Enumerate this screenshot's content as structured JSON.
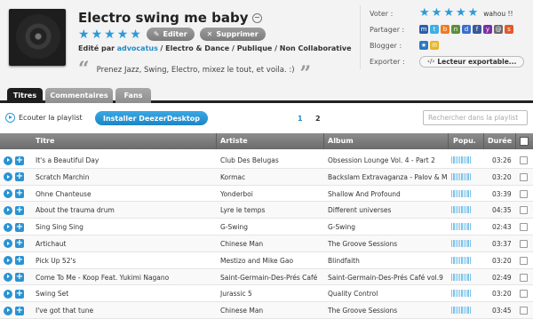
{
  "header": {
    "title": "Electro swing me baby",
    "rating_stars": 5,
    "edit_label": "Editer",
    "delete_label": "Supprimer",
    "edited_by_prefix": "Edité par",
    "author": "advocatus",
    "meta": "/ Electro & Dance / Publique / Non Collaborative",
    "description": "Prenez Jazz, Swing, Electro, mixez le tout, et voila. :)",
    "quote_open": "“",
    "quote_close": "”"
  },
  "side": {
    "vote_label": "Voter :",
    "vote_stars": 5,
    "vote_comment": "wahou !!",
    "share_label": "Partager :",
    "share_icons": [
      "myspace-icon",
      "twitter-icon",
      "blog-icon",
      "netvibes-icon",
      "delicious-icon",
      "facebook-icon",
      "yahoo-icon",
      "email-icon",
      "stumble-icon"
    ],
    "blogger_label": "Blogger :",
    "export_label": "Exporter :",
    "export_button": "Lecteur exportable..."
  },
  "tabs": [
    {
      "label": "Titres",
      "active": true
    },
    {
      "label": "Commentaires",
      "active": false
    },
    {
      "label": "Fans",
      "active": false
    }
  ],
  "toolbar": {
    "listen_label": "Ecouter la playlist",
    "install_label": "Installer DeezerDesktop",
    "pages": [
      "1",
      "2"
    ],
    "search_placeholder": "Rechercher dans la playlist"
  },
  "table": {
    "columns": [
      "Titre",
      "Artiste",
      "Album",
      "Popu.",
      "Durée"
    ],
    "rows": [
      {
        "title": "It's a Beautiful Day",
        "artist": "Club Des Belugas",
        "album": "Obsession Lounge Vol. 4 - Part 2",
        "popularity": 1.0,
        "duration": "03:26"
      },
      {
        "title": "Scratch Marchin",
        "artist": "Kormac",
        "album": "Backslam Extravaganza - Palov & Mi",
        "popularity": 1.0,
        "duration": "03:20"
      },
      {
        "title": "Ohne Chanteuse",
        "artist": "Yonderboi",
        "album": "Shallow And Profound",
        "popularity": 1.0,
        "duration": "03:39"
      },
      {
        "title": "About the trauma drum",
        "artist": "Lyre le temps",
        "album": "Different universes",
        "popularity": 1.0,
        "duration": "04:35"
      },
      {
        "title": "Sing Sing Sing",
        "artist": "G-Swing",
        "album": "G-Swing",
        "popularity": 1.0,
        "duration": "02:43"
      },
      {
        "title": "Artichaut",
        "artist": "Chinese Man",
        "album": "The Groove Sessions",
        "popularity": 1.0,
        "duration": "03:37"
      },
      {
        "title": "Pick Up 52's",
        "artist": "Mestizo and Mike Gao",
        "album": "Blindfaith",
        "popularity": 1.0,
        "duration": "03:20"
      },
      {
        "title": "Come To Me - Koop Feat. Yukimi Nagano",
        "artist": "Saint-Germain-Des-Prés Café",
        "album": "Saint-Germain-Des-Prés Café vol.9",
        "popularity": 1.0,
        "duration": "02:49"
      },
      {
        "title": "Swing Set",
        "artist": "Jurassic 5",
        "album": "Quality Control",
        "popularity": 1.0,
        "duration": "03:20"
      },
      {
        "title": "I've got that tune",
        "artist": "Chinese Man",
        "album": "The Groove Sessions",
        "popularity": 1.0,
        "duration": "03:45"
      }
    ]
  }
}
